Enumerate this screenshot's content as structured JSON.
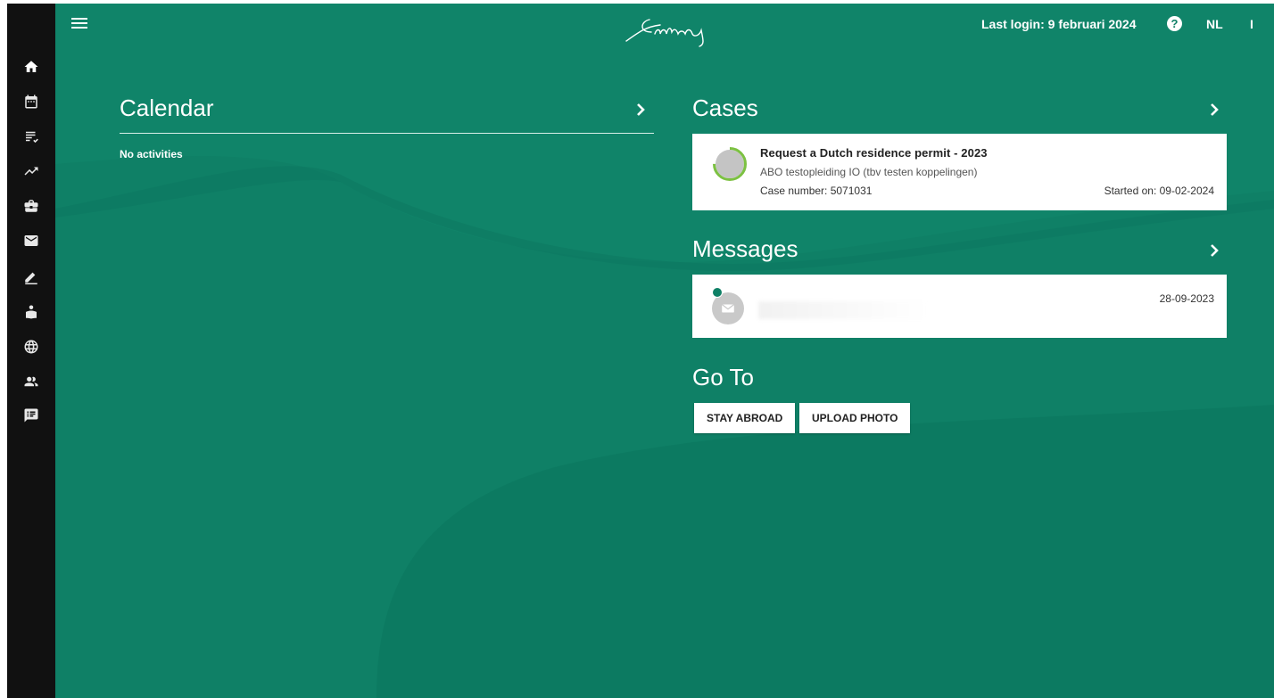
{
  "header": {
    "last_login": "Last login: 9 februari 2024",
    "help_label": "?",
    "language": "NL",
    "user_initial": "I"
  },
  "sidebar": {
    "items": [
      {
        "icon": "home-icon",
        "active": true
      },
      {
        "icon": "calendar-icon"
      },
      {
        "icon": "list-check-icon"
      },
      {
        "icon": "trending-up-icon"
      },
      {
        "icon": "briefcase-icon"
      },
      {
        "icon": "mail-icon"
      },
      {
        "icon": "edit-icon"
      },
      {
        "icon": "reader-icon"
      },
      {
        "icon": "globe-icon"
      },
      {
        "icon": "people-icon"
      },
      {
        "icon": "feedback-icon"
      }
    ]
  },
  "calendar": {
    "title": "Calendar",
    "empty_text": "No activities"
  },
  "cases": {
    "title": "Cases",
    "items": [
      {
        "title": "Request a Dutch residence permit - 2023",
        "subtitle": "ABO testopleiding IO (tbv testen koppelingen)",
        "case_number": "Case number: 5071031",
        "started": "Started on: 09-02-2024",
        "progress": 0.75
      }
    ]
  },
  "messages": {
    "title": "Messages",
    "items": [
      {
        "date": "28-09-2023",
        "unread": true
      }
    ]
  },
  "goto": {
    "title": "Go To",
    "buttons": [
      "STAY ABROAD",
      "UPLOAD PHOTO"
    ]
  },
  "colors": {
    "primary": "#0f8066",
    "sidebar": "#111111",
    "progress": "#7cc142"
  }
}
